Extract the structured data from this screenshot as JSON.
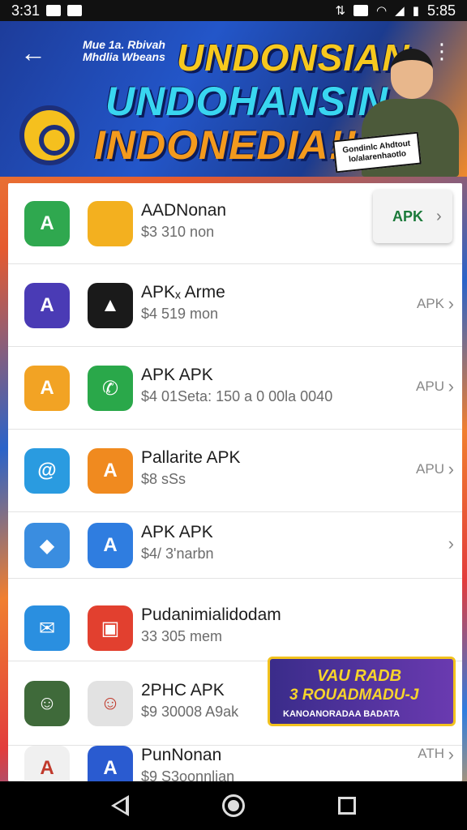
{
  "status_bar": {
    "time": "3:31",
    "left_icons": [
      "notification-icon",
      "youtube-icon"
    ],
    "right_icons": [
      "data-icon",
      "image-icon",
      "wifi-icon",
      "signal-icon",
      "battery-icon"
    ],
    "right_text": "5:85"
  },
  "banner": {
    "small_title": "Mue 1a. Rbivah Mhdlia Wbeans",
    "headline_1": "UNDONSIAN",
    "headline_2": "UNDOHANSIN",
    "headline_3": "INDONEDIA!!",
    "sign_text": "Gondinlc Ahdtout lo/alarenhaotlo",
    "colors": {
      "bg": "#2356c9",
      "yellow": "#f6c81e",
      "cyan": "#39d6f0",
      "orange": "#f39a1d"
    }
  },
  "apps": [
    {
      "title": "AADNonan",
      "sub": "$3 310 non",
      "action": "APK",
      "icon_a": "A",
      "icon_b": "",
      "color_a": "#2fa84f",
      "color_b": "#f3b01f"
    },
    {
      "title": "APKₓ Arme",
      "sub": "$4 519 mon",
      "action": "APK",
      "icon_a": "A",
      "icon_b": "▲",
      "color_a": "#4a3bb5",
      "color_b": "#1a1a1a"
    },
    {
      "title": "APK APK",
      "sub": "$4 01Seta: 150 a 0 00la 0040",
      "action": "APU",
      "icon_a": "A",
      "icon_b": "✆",
      "color_a": "#f2a324",
      "color_b": "#2aa84a"
    },
    {
      "title": "Pallarite APK",
      "sub": "$8 sSs",
      "action": "APU",
      "icon_a": "@",
      "icon_b": "A",
      "color_a": "#2a9be0",
      "color_b": "#f08a1f"
    },
    {
      "title": "APK APK",
      "sub": "$4/ 3'narbn",
      "action": "",
      "icon_a": "◆",
      "icon_b": "A",
      "color_a": "#3a8de0",
      "color_b": "#2f7de0"
    },
    {
      "title": "Pudanimialidodam",
      "sub": "33 305 mem",
      "action": "",
      "icon_a": "✉",
      "icon_b": "▣",
      "color_a": "#2a8fe0",
      "color_b": "#e2402f"
    },
    {
      "title": "2PHC APK",
      "sub": "$9 30008 A9ak",
      "action": "",
      "icon_a": "☺",
      "icon_b": "☺",
      "color_a": "#3f6a3a",
      "color_b": "#e2e2e2"
    },
    {
      "title": "PunNonan",
      "sub": "$9 S3oonnlian",
      "action": "ATH",
      "icon_a": "A",
      "icon_b": "A",
      "color_a": "#f0f0f0",
      "color_b": "#2a5bd0"
    }
  ],
  "promo": {
    "line_1": "VAU RADB",
    "line_2": "3 ROUADMADU-J",
    "line_3": "KANOANORADAA BADATA"
  },
  "nav": {
    "back": "back-icon",
    "home": "home-icon",
    "recents": "recents-icon"
  }
}
